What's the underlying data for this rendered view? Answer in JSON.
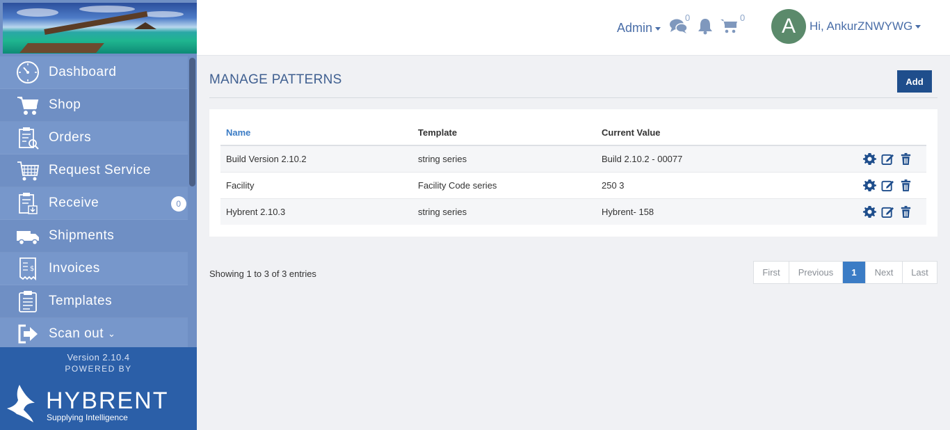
{
  "topbar": {
    "role_label": "Admin",
    "chat_count": "0",
    "cart_count": "0",
    "avatar_letter": "A",
    "greeting": "Hi, AnkurZNWYWG"
  },
  "sidebar": {
    "items": [
      {
        "label": "Dashboard",
        "icon": "dashboard-icon"
      },
      {
        "label": "Shop",
        "icon": "cart-icon"
      },
      {
        "label": "Orders",
        "icon": "orders-icon"
      },
      {
        "label": "Request Service",
        "icon": "service-icon"
      },
      {
        "label": "Receive",
        "icon": "receive-icon",
        "badge": "0"
      },
      {
        "label": "Shipments",
        "icon": "truck-icon"
      },
      {
        "label": "Invoices",
        "icon": "invoice-icon"
      },
      {
        "label": "Templates",
        "icon": "clipboard-icon"
      },
      {
        "label": "Scan out",
        "icon": "exit-icon"
      }
    ],
    "version": "Version 2.10.4",
    "powered_by": "POWERED BY",
    "logo_text": "HYBRENT",
    "logo_sub": "Supplying Intelligence"
  },
  "main": {
    "title": "MANAGE PATTERNS",
    "add_label": "Add",
    "table": {
      "headers": [
        "Name",
        "Template",
        "Current Value"
      ],
      "rows": [
        {
          "name": "Build Version 2.10.2",
          "template": "string series",
          "value": "Build 2.10.2 - 00077"
        },
        {
          "name": "Facility",
          "template": "Facility Code series",
          "value": "250 3"
        },
        {
          "name": "Hybrent 2.10.3",
          "template": "string series",
          "value": "Hybrent- 158"
        }
      ]
    },
    "info": "Showing 1 to 3 of 3 entries",
    "pager": {
      "first": "First",
      "previous": "Previous",
      "current": "1",
      "next": "Next",
      "last": "Last"
    }
  },
  "colors": {
    "accent": "#1f4e8c",
    "sidebar": "#6f8fc4",
    "link": "#3b7cc5"
  }
}
